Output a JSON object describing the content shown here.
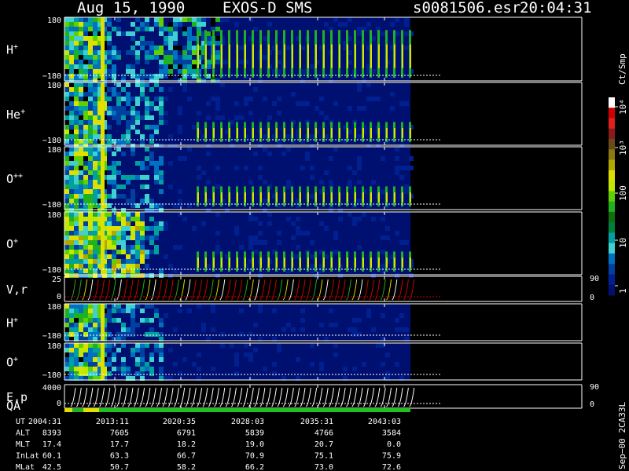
{
  "header": {
    "date": "Aug 15, 1990",
    "instrument": "EXOS-D SMS",
    "file": "s0081506.esr",
    "time": "20:04:31"
  },
  "colorbar": {
    "title": "Ct/Smp",
    "labels": [
      "10⁴",
      "10³",
      "100",
      "10",
      "1"
    ],
    "colors": [
      "#ffffff",
      "#d00000",
      "#e02020",
      "#8b1a1a",
      "#6b4a1a",
      "#8a7a10",
      "#b0a800",
      "#e0e000",
      "#c0e800",
      "#60d000",
      "#20b020",
      "#107010",
      "#008040",
      "#00a0a0",
      "#40d0d0",
      "#0070c0",
      "#0040a0",
      "#002090",
      "#001070"
    ]
  },
  "chart_data": {
    "type": "heatmap",
    "panels": [
      {
        "label": "H",
        "sup": "+",
        "ymax": "180",
        "ymin": "−180"
      },
      {
        "label": "He",
        "sup": "+",
        "ymax": "180",
        "ymin": "−180"
      },
      {
        "label": "O",
        "sup": "++",
        "ymax": "180",
        "ymin": "−180"
      },
      {
        "label": "O",
        "sup": "+",
        "ymax": "180",
        "ymin": "−180"
      },
      {
        "label": "V,r",
        "sup": "",
        "ymax": "25",
        "ymin": "0",
        "right_max": "90",
        "right_min": "0"
      },
      {
        "label": "H",
        "sup": "+",
        "ymax": "180",
        "ymin": "−180"
      },
      {
        "label": "O",
        "sup": "+",
        "ymax": "180",
        "ymin": "−180"
      },
      {
        "label": "E,p",
        "sup": "",
        "ymax": "4000",
        "ymin": "0",
        "right_max": "90",
        "right_min": "0"
      }
    ],
    "qa_label": "QA",
    "side_text": "Sep−00  2CA33L",
    "ephemeris": {
      "labels": [
        "UT",
        "ALT",
        "MLT",
        "InLat",
        "MLat"
      ],
      "columns": [
        {
          "UT": "2004:31",
          "ALT": "8393",
          "MLT": "17.4",
          "InLat": "60.1",
          "MLat": "42.5"
        },
        {
          "UT": "2013:11",
          "ALT": "7605",
          "MLT": "17.7",
          "InLat": "63.3",
          "MLat": "50.7"
        },
        {
          "UT": "2020:35",
          "ALT": "6791",
          "MLT": "18.2",
          "InLat": "66.7",
          "MLat": "58.2"
        },
        {
          "UT": "2028:03",
          "ALT": "5839",
          "MLT": "19.0",
          "InLat": "70.9",
          "MLat": "66.2"
        },
        {
          "UT": "2035:31",
          "ALT": "4766",
          "MLT": "20.7",
          "InLat": "75.1",
          "MLat": "73.0"
        },
        {
          "UT": "2043:03",
          "ALT": "3584",
          "MLT": "0.0",
          "InLat": "75.9",
          "MLat": "72.6"
        }
      ]
    }
  }
}
